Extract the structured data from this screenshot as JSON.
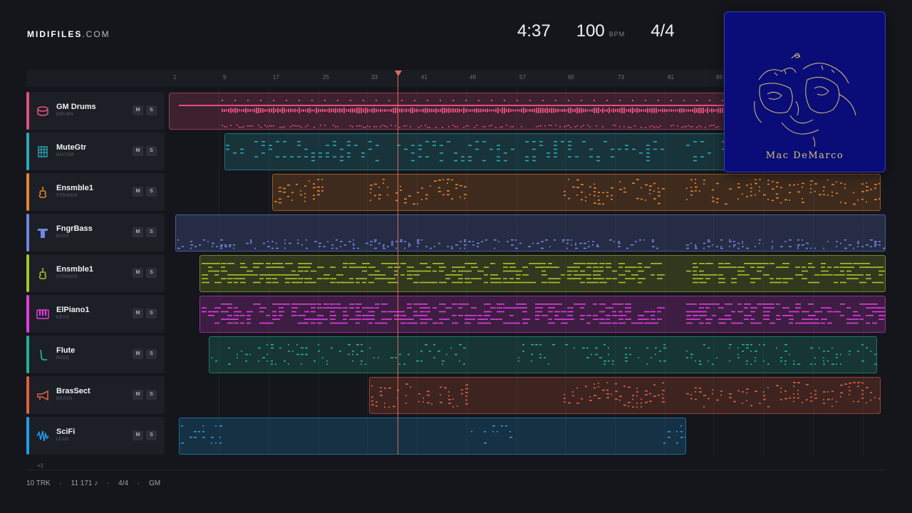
{
  "brand": {
    "name": "MIDIFILES",
    "domain": ".COM"
  },
  "stats": {
    "time": "4:37",
    "bpm": "100",
    "bpm_unit": "BPM",
    "signature": "4/4"
  },
  "ruler": [
    "1",
    "9",
    "17",
    "25",
    "33",
    "41",
    "49",
    "57",
    "65",
    "73",
    "81",
    "89"
  ],
  "tracks": [
    {
      "name": "GM Drums",
      "category": "DRUMS",
      "icon": "drum-icon",
      "color": "#e0507e",
      "mute": "M",
      "solo": "S"
    },
    {
      "name": "MuteGtr",
      "category": "GUITAR",
      "icon": "guitar-icon",
      "color": "#2aa9b8",
      "mute": "M",
      "solo": "S"
    },
    {
      "name": "Ensmble1",
      "category": "STRINGS",
      "icon": "violin-icon",
      "color": "#e8842c",
      "mute": "M",
      "solo": "S"
    },
    {
      "name": "FngrBass",
      "category": "BASS",
      "icon": "bass-icon",
      "color": "#6f86e6",
      "mute": "M",
      "solo": "S"
    },
    {
      "name": "Ensmble1",
      "category": "STRINGS",
      "icon": "violin-icon",
      "color": "#a6c42a",
      "mute": "M",
      "solo": "S"
    },
    {
      "name": "ElPiano1",
      "category": "KEYS",
      "icon": "piano-icon",
      "color": "#e03ce0",
      "mute": "M",
      "solo": "S"
    },
    {
      "name": "Flute",
      "category": "REED",
      "icon": "flute-icon",
      "color": "#21b294",
      "mute": "M",
      "solo": "S"
    },
    {
      "name": "BrasSect",
      "category": "BRASS",
      "icon": "horn-icon",
      "color": "#e0603e",
      "mute": "M",
      "solo": "S"
    },
    {
      "name": "SciFi",
      "category": "LEAD",
      "icon": "synth-wave-icon",
      "color": "#1f9ee8",
      "mute": "M",
      "solo": "S"
    }
  ],
  "more_tracks": "+1",
  "footer": {
    "tracks": "10 TRK",
    "notes": "11 171 ♪",
    "signature": "4/4",
    "standard": "GM",
    "sep": "·"
  },
  "album": {
    "artist": "Mac DeMarco"
  }
}
